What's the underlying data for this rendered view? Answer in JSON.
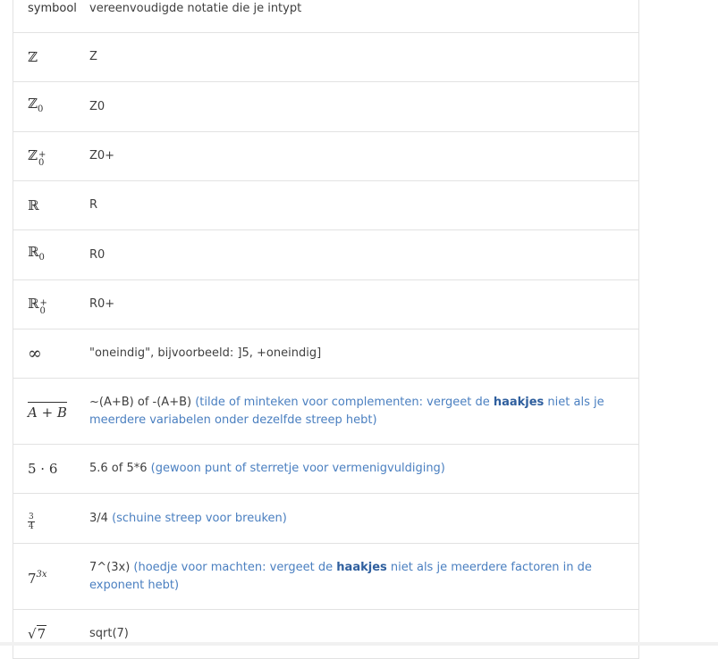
{
  "header": {
    "col_symbol": "symbool",
    "col_notation": "vereenvoudigde notatie die je intypt"
  },
  "rows": [
    {
      "notation": "Z"
    },
    {
      "notation": "Z0"
    },
    {
      "notation": "Z0+"
    },
    {
      "notation": "R"
    },
    {
      "notation": "R0"
    },
    {
      "notation": "R0+"
    },
    {
      "notation": "\"oneindig\", bijvoorbeeld: ]5, +oneindig]"
    },
    {
      "notation": "~(A+B) of -(A+B)",
      "hint_a": "(tilde of minteken voor complementen: vergeet de ",
      "hint_bold": "haakjes",
      "hint_b": " niet als je meerdere variabelen onder dezelfde streep hebt)"
    },
    {
      "notation": "5.6 of 5*6",
      "hint": "(gewoon punt of sterretje voor vermenigvuldiging)"
    },
    {
      "notation": "3/4",
      "hint": "(schuine streep voor breuken)"
    },
    {
      "notation": "7^(3x)",
      "hint_a": "(hoedje voor machten: vergeet de ",
      "hint_bold": "haakjes",
      "hint_b": " niet als je meerdere factoren in de exponent hebt)"
    },
    {
      "notation": "sqrt(7)"
    }
  ],
  "symbols": {
    "Z": "ℤ",
    "R": "ℝ",
    "zero": "0",
    "plus": "+",
    "inf": "∞",
    "AB": "A + B",
    "dot": "5 · 6",
    "num": "3",
    "den": "4",
    "base": "7",
    "exp": "3x",
    "root": "√",
    "radicand": "7"
  }
}
